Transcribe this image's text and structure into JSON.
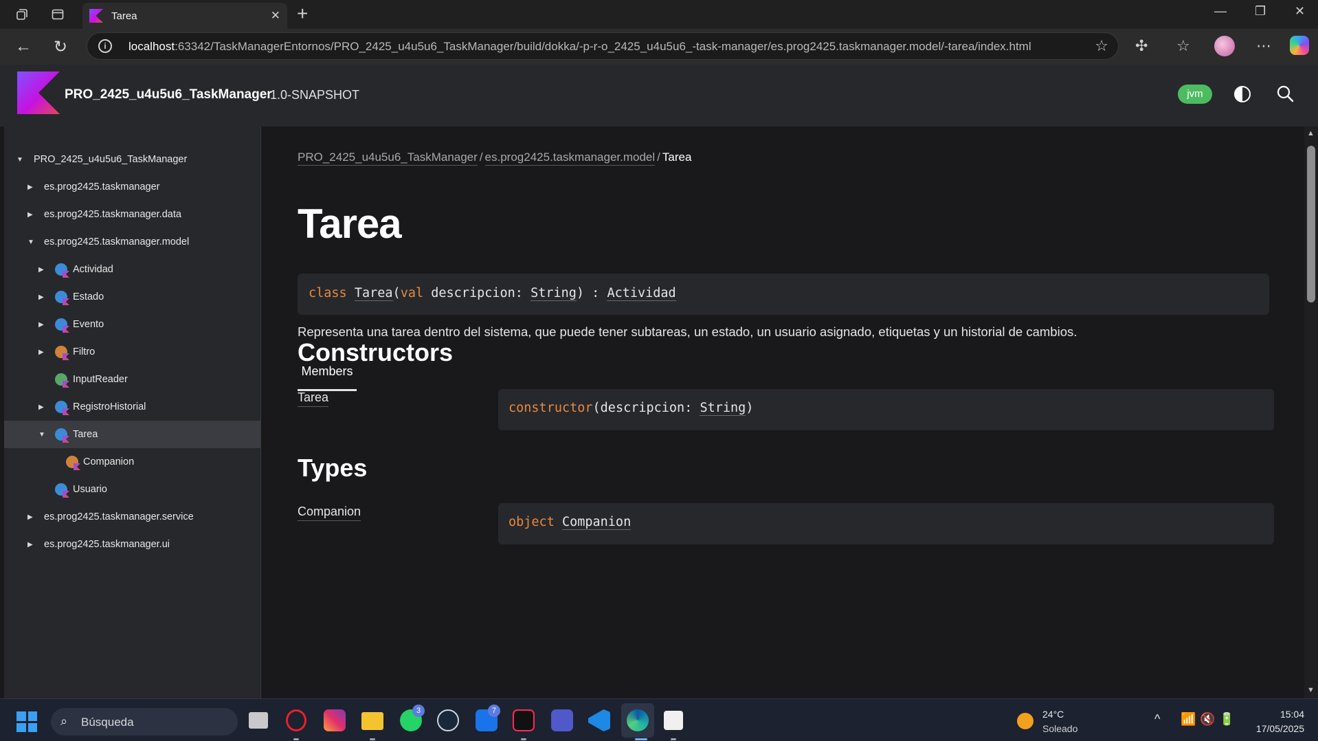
{
  "browser": {
    "tab_title": "Tarea",
    "url_host": "localhost",
    "url_rest": ":63342/TaskManagerEntornos/PRO_2425_u4u5u6_TaskManager/build/dokka/-p-r-o_2425_u4u5u6_-task-manager/es.prog2425.taskmanager.model/-tarea/index.html"
  },
  "header": {
    "project_name": "PRO_2425_u4u5u6_TaskManager",
    "version": "1.0-SNAPSHOT",
    "platform_badge": "jvm"
  },
  "sidebar": {
    "items": [
      {
        "label": "PRO_2425_u4u5u6_TaskManager",
        "caret": "▼",
        "icon": "",
        "level": 0
      },
      {
        "label": "es.prog2425.taskmanager",
        "caret": "▶",
        "icon": "",
        "level": 1
      },
      {
        "label": "es.prog2425.taskmanager.data",
        "caret": "▶",
        "icon": "",
        "level": 1
      },
      {
        "label": "es.prog2425.taskmanager.model",
        "caret": "▼",
        "icon": "",
        "level": 1
      },
      {
        "label": "Actividad",
        "caret": "▶",
        "icon": "abstract-class-icon",
        "level": 2
      },
      {
        "label": "Estado",
        "caret": "▶",
        "icon": "enum-class-icon",
        "level": 2
      },
      {
        "label": "Evento",
        "caret": "▶",
        "icon": "class-icon",
        "level": 2
      },
      {
        "label": "Filtro",
        "caret": "▶",
        "icon": "object-icon",
        "level": 2
      },
      {
        "label": "InputReader",
        "caret": "",
        "icon": "function-icon",
        "level": 2
      },
      {
        "label": "RegistroHistorial",
        "caret": "▶",
        "icon": "class-icon",
        "level": 2
      },
      {
        "label": "Tarea",
        "caret": "▼",
        "icon": "class-icon",
        "level": 2
      },
      {
        "label": "Companion",
        "caret": "",
        "icon": "object-icon",
        "level": 3
      },
      {
        "label": "Usuario",
        "caret": "",
        "icon": "class-icon",
        "level": 2
      },
      {
        "label": "es.prog2425.taskmanager.service",
        "caret": "▶",
        "icon": "",
        "level": 1
      },
      {
        "label": "es.prog2425.taskmanager.ui",
        "caret": "▶",
        "icon": "",
        "level": 1
      }
    ],
    "selected": "Tarea"
  },
  "breadcrumb": {
    "root": "PRO_2425_u4u5u6_TaskManager",
    "package": "es.prog2425.taskmanager.model",
    "separator": "/",
    "current": "Tarea"
  },
  "page": {
    "title": "Tarea",
    "signature": {
      "kw_class": "class",
      "name": "Tarea",
      "open_paren": "(",
      "kw_val": "val",
      "param": "descripcion",
      "colon": ":",
      "param_type": "String",
      "close": ")",
      "super_colon": ":",
      "supertype": "Actividad"
    },
    "description": "Representa una tarea dentro del sistema, que puede tener subtareas, un estado, un usuario asignado, etiquetas y un historial de cambios.",
    "members_tab": "Members",
    "constructors_title": "Constructors",
    "constructor": {
      "name": "Tarea",
      "keyword": "constructor",
      "open": "(",
      "param": "descripcion",
      "colon": ":",
      "param_type": "String",
      "close": ")"
    },
    "types_title": "Types",
    "type": {
      "name": "Companion",
      "keyword": "object",
      "type_name": "Companion"
    }
  },
  "taskbar": {
    "search_placeholder": "Búsqueda",
    "whatsapp_badge": "3",
    "mail_badge": "7",
    "weather_temp": "24°C",
    "weather_desc": "Soleado",
    "time": "15:04",
    "date": "17/05/2025"
  },
  "colors": {
    "accent_keyword": "#e68a3f",
    "badge_green": "#4dbb5f",
    "kotlin_gradient_start": "#7f52ff",
    "kotlin_gradient_end": "#e44857"
  }
}
